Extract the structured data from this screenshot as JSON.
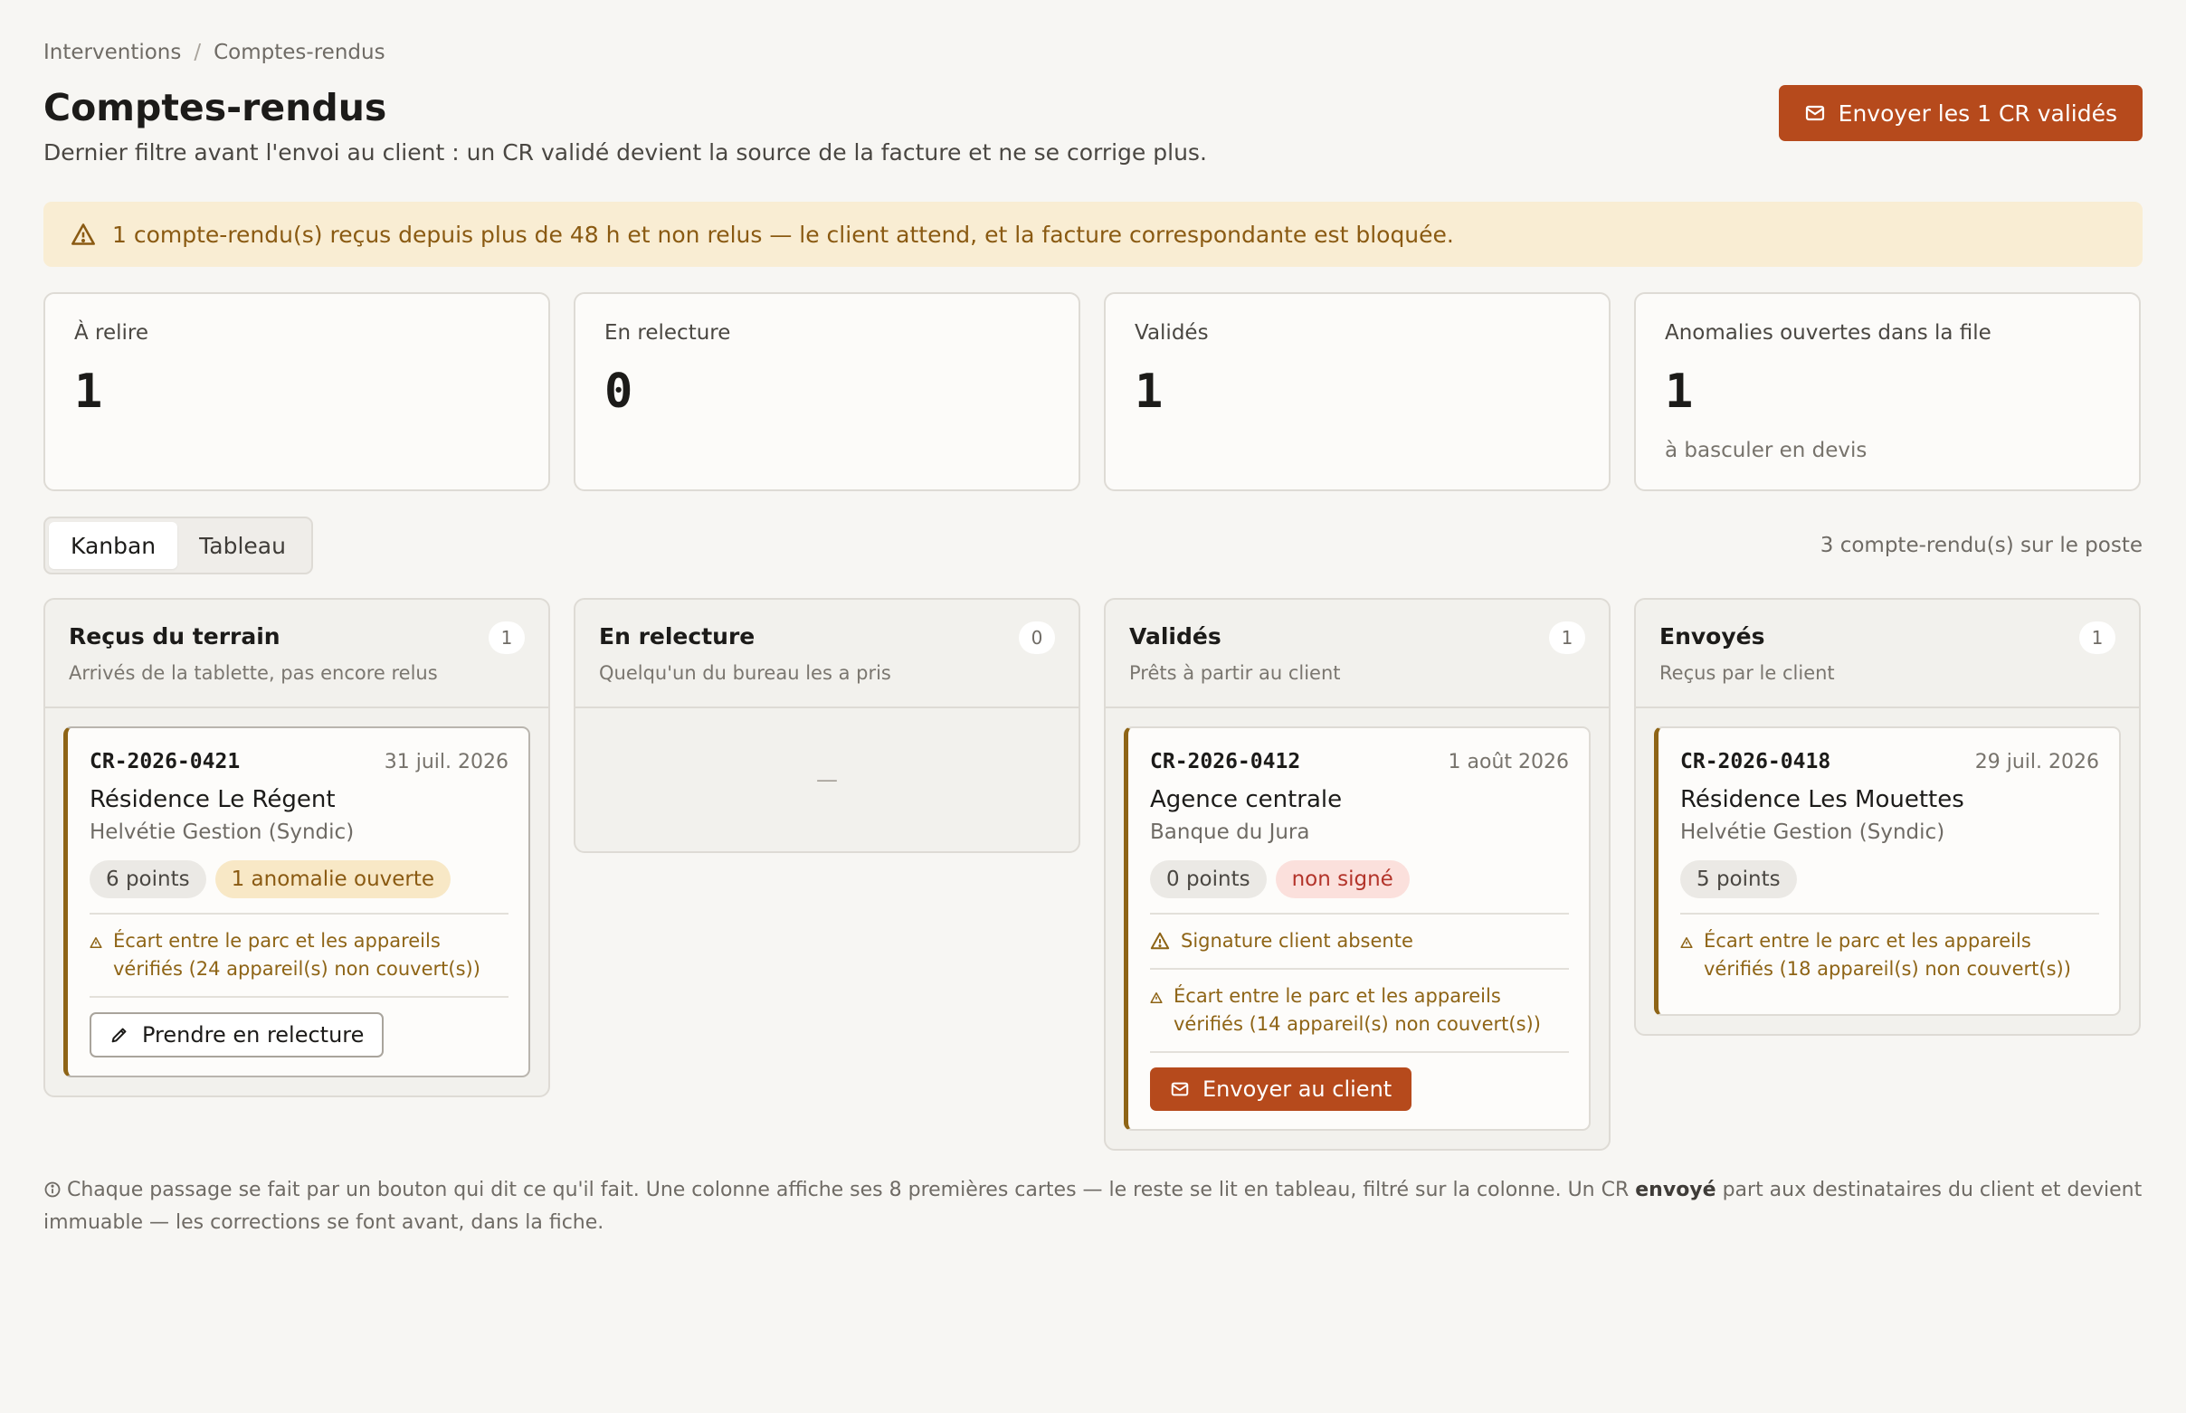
{
  "breadcrumb": {
    "parent": "Interventions",
    "separator": "/",
    "current": "Comptes-rendus"
  },
  "header": {
    "title": "Comptes-rendus",
    "subtitle": "Dernier filtre avant l'envoi au client : un CR validé devient la source de la facture et ne se corrige plus.",
    "send_all_label": "Envoyer les 1 CR validés"
  },
  "alert": {
    "text": "1 compte-rendu(s) reçus depuis plus de 48 h et non relus — le client attend, et la facture correspondante est bloquée."
  },
  "stats": [
    {
      "label": "À relire",
      "value": "1",
      "sub": ""
    },
    {
      "label": "En relecture",
      "value": "0",
      "sub": ""
    },
    {
      "label": "Validés",
      "value": "1",
      "sub": ""
    },
    {
      "label": "Anomalies ouvertes dans la file",
      "value": "1",
      "sub": "à basculer en devis"
    }
  ],
  "view": {
    "kanban_label": "Kanban",
    "table_label": "Tableau",
    "count_text": "3 compte-rendu(s) sur le poste"
  },
  "columns": [
    {
      "title": "Reçus du terrain",
      "desc": "Arrivés de la tablette, pas encore relus",
      "count": "1",
      "card": {
        "id": "CR-2026-0421",
        "date": "31 juil. 2026",
        "site": "Résidence Le Régent",
        "client": "Helvétie Gestion (Syndic)",
        "pill1": "6 points",
        "pill2": "1 anomalie ouverte",
        "warning": "Écart entre le parc et les appareils vérifiés (24 appareil(s) non couvert(s))",
        "action": "Prendre en relecture"
      }
    },
    {
      "title": "En relecture",
      "desc": "Quelqu'un du bureau les a pris",
      "count": "0",
      "empty": "—"
    },
    {
      "title": "Validés",
      "desc": "Prêts à partir au client",
      "count": "1",
      "card": {
        "id": "CR-2026-0412",
        "date": "1 août 2026",
        "site": "Agence centrale",
        "client": "Banque du Jura",
        "pill1": "0 points",
        "pill2": "non signé",
        "warning1": "Signature client absente",
        "warning2": "Écart entre le parc et les appareils vérifiés (14 appareil(s) non couvert(s))",
        "action": "Envoyer au client"
      }
    },
    {
      "title": "Envoyés",
      "desc": "Reçus par le client",
      "count": "1",
      "card": {
        "id": "CR-2026-0418",
        "date": "29 juil. 2026",
        "site": "Résidence Les Mouettes",
        "client": "Helvétie Gestion (Syndic)",
        "pill1": "5 points",
        "warning": "Écart entre le parc et les appareils vérifiés (18 appareil(s) non couvert(s))"
      }
    }
  ],
  "footer": {
    "part1": "Chaque passage se fait par un bouton qui dit ce qu'il fait. Une colonne affiche ses 8 premières cartes — le reste se lit en tableau, filtré sur la colonne. Un CR ",
    "bold": "envoyé",
    "part2": " part aux destinataires du client et devient immuable — les corrections se font avant, dans la fiche."
  },
  "colors": {
    "accent": "#b64a1c",
    "warning": "#8e6416",
    "alert_bg": "#f9edd3",
    "danger": "#b3342a"
  }
}
